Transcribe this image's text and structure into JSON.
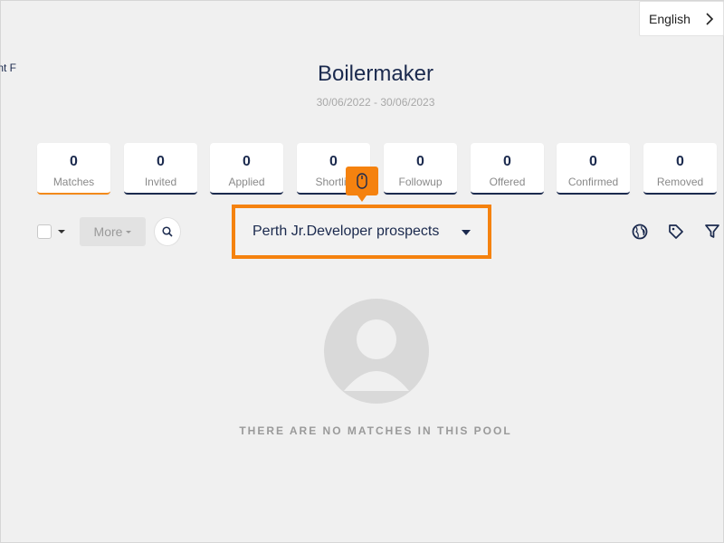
{
  "sidebar": {
    "cutoff_text": "nt F"
  },
  "header": {
    "language": "English"
  },
  "pool": {
    "title": "Boilermaker",
    "date_range": "30/06/2022 - 30/06/2023"
  },
  "stats": [
    {
      "value": "0",
      "label": "Matches",
      "active": true
    },
    {
      "value": "0",
      "label": "Invited"
    },
    {
      "value": "0",
      "label": "Applied"
    },
    {
      "value": "0",
      "label": "Shortlis"
    },
    {
      "value": "0",
      "label": "Followup"
    },
    {
      "value": "0",
      "label": "Offered"
    },
    {
      "value": "0",
      "label": "Confirmed"
    },
    {
      "value": "0",
      "label": "Removed"
    }
  ],
  "toolbar": {
    "more_label": "More",
    "pool_selector_value": "Perth Jr.Developer prospects",
    "icons": [
      "globe-icon",
      "tag-icon",
      "filter-icon",
      "search-icon",
      "mouse-icon"
    ]
  },
  "empty_state": {
    "message": "THERE ARE NO MATCHES IN THIS POOL"
  },
  "colors": {
    "accent": "#f5820f",
    "navy": "#1b2a4e",
    "background": "#f0f0f0"
  }
}
